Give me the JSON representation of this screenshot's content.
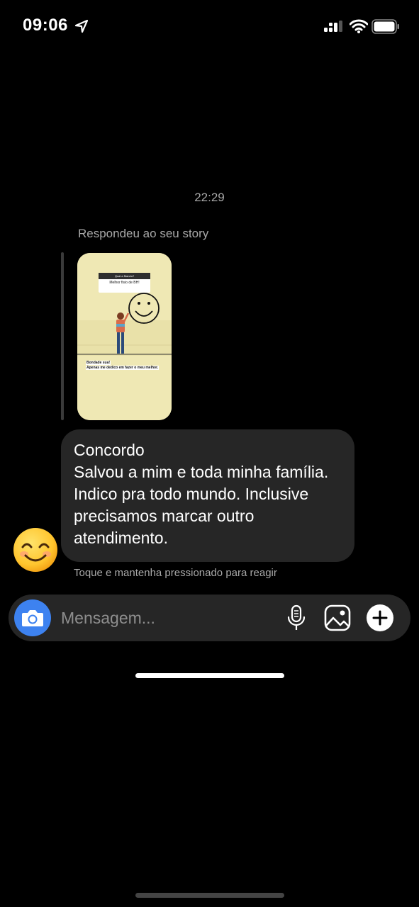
{
  "status_bar": {
    "time": "09:06"
  },
  "chat": {
    "timestamp": "22:29",
    "reply_note": "Respondeu ao seu story",
    "story": {
      "question_head": "Qual a Mandu?",
      "answer": "Melhor fisio de BH!",
      "caption_line1": "Bondade sua!",
      "caption_line2": "Apenas me dedico em fazer o meu melhor."
    },
    "message_lines": [
      "Concordo",
      "Salvou a mim e toda minha família.",
      "Indico pra todo mundo. Inclusive",
      "precisamos marcar outro",
      "atendimento."
    ],
    "reaction_emoji": "smiling-face-emoji",
    "hint": "Toque e mantenha pressionado para reagir"
  },
  "composer": {
    "placeholder": "Mensagem..."
  },
  "colors": {
    "background": "#000000",
    "bubble": "#262626",
    "camera_button": "#3d82f0",
    "secondary_text": "#a8a8a8"
  }
}
